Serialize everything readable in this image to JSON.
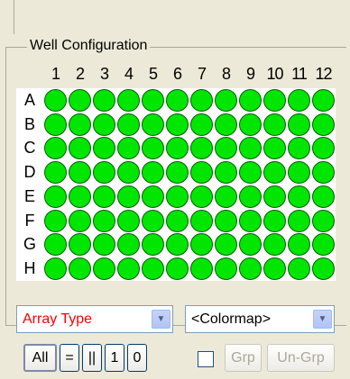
{
  "group": {
    "title": "Well Configuration"
  },
  "plate": {
    "columns": [
      "1",
      "2",
      "3",
      "4",
      "5",
      "6",
      "7",
      "8",
      "9",
      "10",
      "11",
      "12"
    ],
    "rows": [
      "A",
      "B",
      "C",
      "D",
      "E",
      "F",
      "G",
      "H"
    ],
    "well_color": "#00e600"
  },
  "controls": {
    "array_type": {
      "value": "Array Type",
      "color": "#ff0000"
    },
    "colormap": {
      "value": "<Colormap>"
    }
  },
  "buttons": {
    "all": "All",
    "equal": "=",
    "parallel": "||",
    "one": "1",
    "zero": "0",
    "grp": "Grp",
    "ungrp": "Un-Grp"
  }
}
